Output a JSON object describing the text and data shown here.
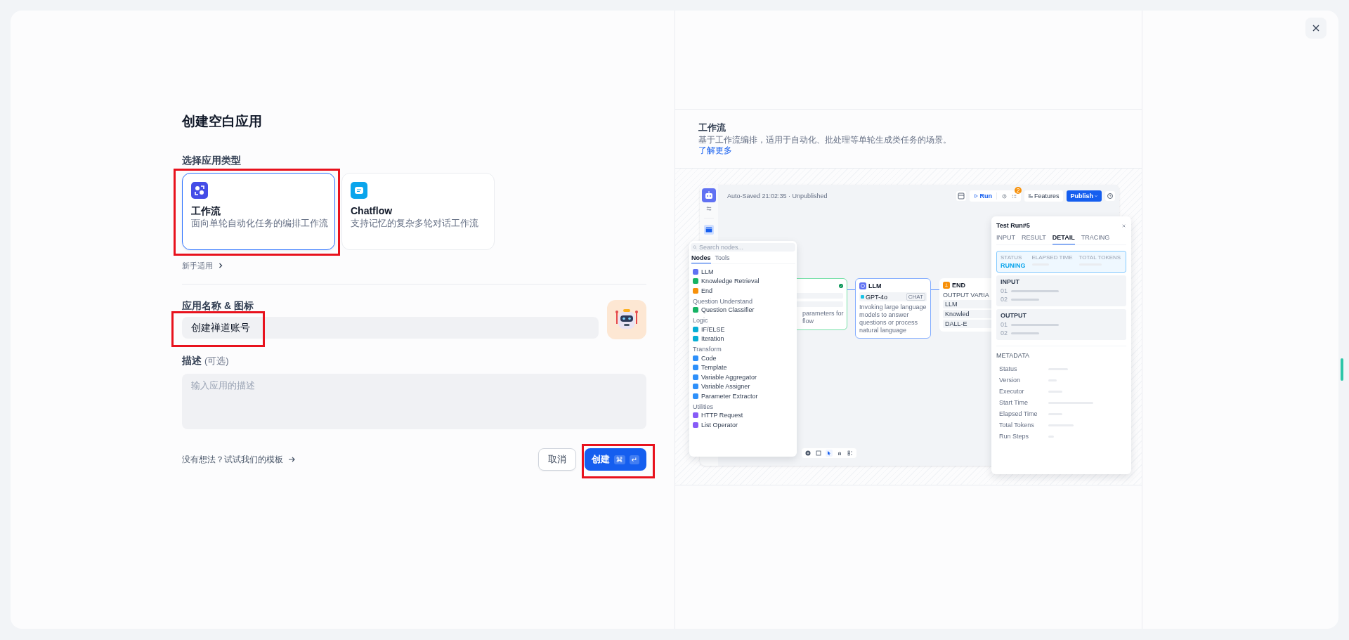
{
  "dialog": {
    "title": "创建空白应用"
  },
  "app_type": {
    "label": "选择应用类型",
    "options": [
      {
        "kind": "workflow",
        "name": "工作流",
        "description": "面向单轮自动化任务的编排工作流",
        "selected": true,
        "highlighted": true
      },
      {
        "kind": "chatflow",
        "name": "Chatflow",
        "description": "支持记忆的复杂多轮对话工作流",
        "selected": false,
        "highlighted": false
      }
    ],
    "beginner_link": "新手适用"
  },
  "name_field": {
    "label": "应用名称 & 图标",
    "value": "创建禅道账号",
    "highlighted": true
  },
  "description_field": {
    "label": "描述",
    "optional": "(可选)",
    "placeholder": "输入应用的描述"
  },
  "template_link": "没有想法？试试我们的模板",
  "buttons": [
    {
      "kind": "cancel",
      "label": "取消"
    },
    {
      "kind": "create",
      "label": "创建",
      "shortcut": [
        "⌘",
        "↵"
      ],
      "highlighted": true
    }
  ],
  "preview_info": {
    "title": "工作流",
    "description": "基于工作流编排，适用于自动化、批处理等单轮生成类任务的场景。",
    "link": "了解更多"
  },
  "preview": {
    "saved_status": "Auto-Saved 21:02:35 · Unpublished",
    "toolbar": {
      "run": "Run",
      "badge": "2",
      "features": "Features",
      "publish": "Publish"
    },
    "node_search": {
      "placeholder": "Search nodes..."
    },
    "node_tabs": [
      {
        "label": "Nodes",
        "selected": true
      },
      {
        "label": "Tools",
        "selected": false
      }
    ],
    "node_groups": [
      {
        "items": [
          {
            "label": "LLM",
            "color": "#6172f3"
          },
          {
            "label": "Knowledge Retrieval",
            "color": "#16b364"
          },
          {
            "label": "End",
            "color": "#f79009"
          }
        ]
      },
      {
        "title": "Question Understand",
        "items": [
          {
            "label": "Question Classifier",
            "color": "#16b364"
          }
        ]
      },
      {
        "title": "Logic",
        "items": [
          {
            "label": "IF/ELSE",
            "color": "#06aed4"
          },
          {
            "label": "Iteration",
            "color": "#06aed4"
          }
        ]
      },
      {
        "title": "Transform",
        "items": [
          {
            "label": "Code",
            "color": "#2e90fa"
          },
          {
            "label": "Template",
            "color": "#2e90fa"
          },
          {
            "label": "Variable Aggregator",
            "color": "#2e90fa"
          },
          {
            "label": "Variable Assigner",
            "color": "#2e90fa"
          },
          {
            "label": "Parameter Extractor",
            "color": "#2e90fa"
          }
        ]
      },
      {
        "title": "Utilities",
        "items": [
          {
            "label": "HTTP Request",
            "color": "#875bf7"
          },
          {
            "label": "List Operator",
            "color": "#875bf7"
          }
        ]
      }
    ],
    "start_node": {
      "text_lines": [
        "parameters for",
        "flow"
      ]
    },
    "llm_node": {
      "title": "LLM",
      "model": "GPT-4o",
      "mode": "CHAT",
      "description": "Invoking large language models to answer questions or process natural language"
    },
    "end_node": {
      "title": "END",
      "section": "OUTPUT VARIA",
      "outputs": [
        "LLM",
        "Knowled",
        "DALL-E"
      ]
    },
    "test_run": {
      "title": "Test Run#5",
      "tabs": [
        {
          "label": "INPUT",
          "selected": false
        },
        {
          "label": "RESULT",
          "selected": false
        },
        {
          "label": "DETAIL",
          "selected": true
        },
        {
          "label": "TRACING",
          "selected": false
        }
      ],
      "status": {
        "labels": [
          "STATUS",
          "ELAPSED TIME",
          "TOTAL TOKENS"
        ],
        "value": "RUNING"
      },
      "sections": [
        {
          "title": "INPUT",
          "rows": [
            "01",
            "02"
          ]
        },
        {
          "title": "OUTPUT",
          "rows": [
            "01",
            "02"
          ]
        }
      ],
      "metadata": {
        "title": "METADATA",
        "rows": [
          "Status",
          "Version",
          "Executor",
          "Start Time",
          "Elapsed Time",
          "Total Tokens",
          "Run Steps"
        ]
      }
    }
  }
}
